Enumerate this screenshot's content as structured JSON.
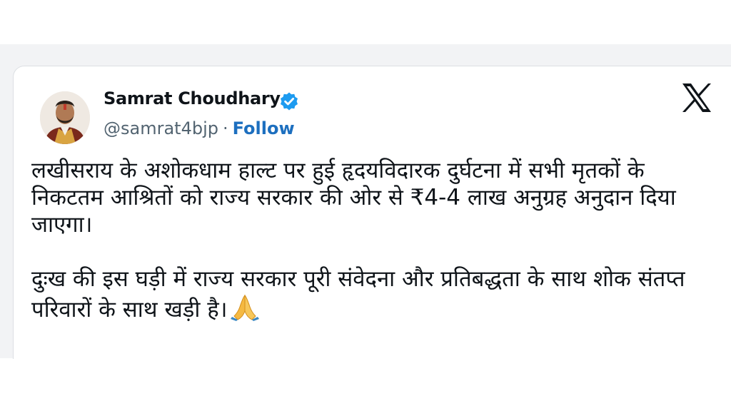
{
  "tweet": {
    "author": {
      "name": "Samrat Choudhary",
      "handle": "@samrat4bjp",
      "separator": "·",
      "follow_label": "Follow",
      "verified": true
    },
    "platform_icon": "x-logo-icon",
    "paragraphs": [
      "लखीसराय के अशोकधाम हाल्ट पर हुई हृदयविदारक दुर्घटना में सभी मृतकों के निकटतम आश्रितों को राज्य सरकार की ओर से ₹4-4 लाख अनुग्रह अनुदान दिया जाएगा।",
      "दुःख की इस घड़ी में राज्य सरकार पूरी संवेदना और प्रतिबद्धता के साथ शोक संतप्त परिवारों के साथ खड़ी है।"
    ],
    "trailing_emoji": "folded-hands-icon",
    "colors": {
      "verified": "#1d9bf0",
      "follow": "#1d6fbf",
      "text": "#0f1419",
      "muted": "#536471"
    }
  }
}
